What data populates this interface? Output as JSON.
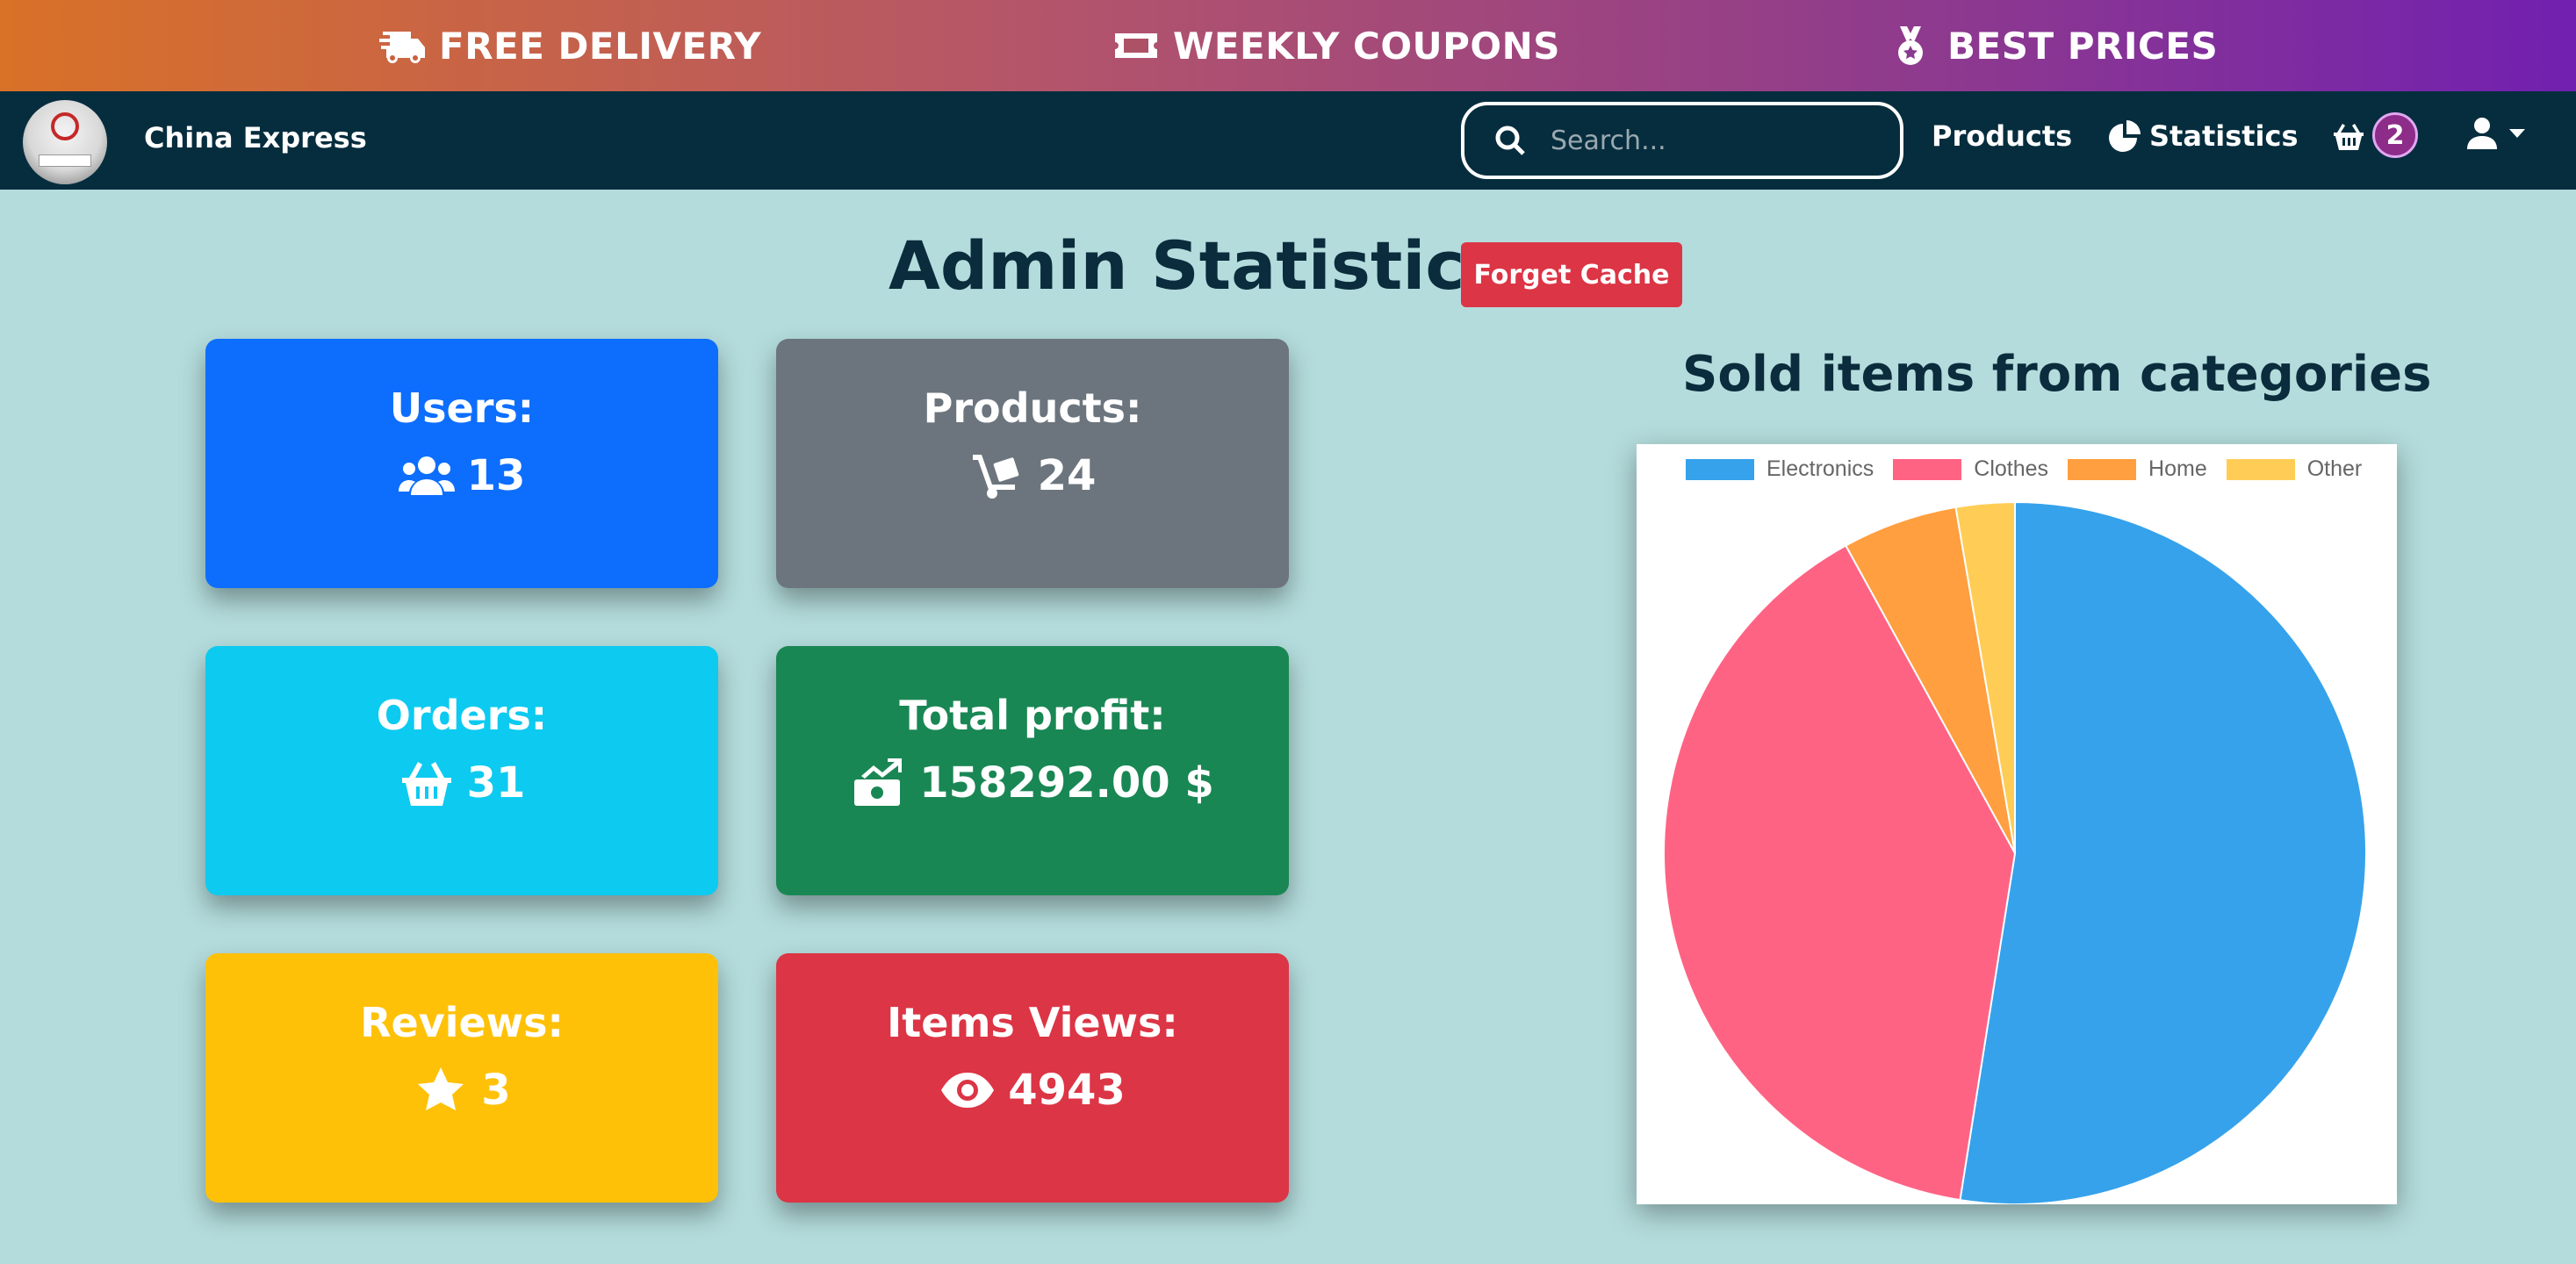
{
  "promo": {
    "delivery": "FREE DELIVERY",
    "coupons": "WEEKLY COUPONS",
    "prices": "BEST PRICES"
  },
  "nav": {
    "brand": "China Express",
    "search_placeholder": "Search...",
    "products": "Products",
    "statistics": "Statistics",
    "cart_count": "2"
  },
  "page": {
    "title": "Admin Statistics",
    "forget_cache": "Forget Cache"
  },
  "cards": {
    "users": {
      "label": "Users:",
      "value": "13",
      "color": "#0d6efd"
    },
    "products": {
      "label": "Products:",
      "value": "24",
      "color": "#6c757d"
    },
    "orders": {
      "label": "Orders:",
      "value": "31",
      "color": "#0dcaf0"
    },
    "profit": {
      "label": "Total profit:",
      "value": "158292.00 $",
      "color": "#198754"
    },
    "reviews": {
      "label": "Reviews:",
      "value": "3",
      "color": "#ffc107"
    },
    "views": {
      "label": "Items Views:",
      "value": "4943",
      "color": "#dc3545"
    }
  },
  "chart_data": {
    "type": "pie",
    "title": "Sold items from categories",
    "categories": [
      "Electronics",
      "Clothes",
      "Home",
      "Other"
    ],
    "values": [
      52.5,
      39.5,
      5.3,
      2.7
    ],
    "colors": [
      "#36a2eb",
      "#ff6384",
      "#ff9f40",
      "#ffcd56"
    ],
    "legend_position": "top"
  }
}
